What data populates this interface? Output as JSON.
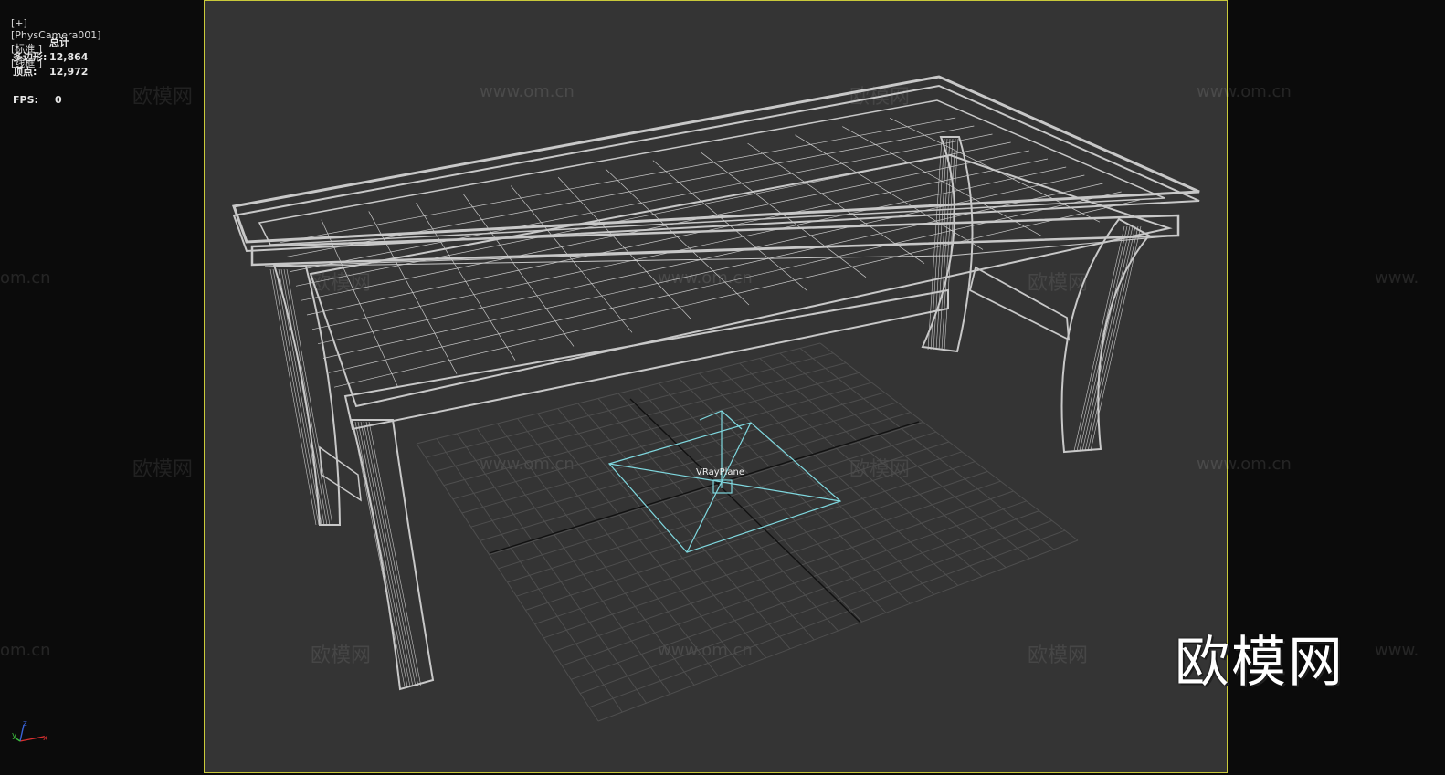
{
  "viewport": {
    "labels": [
      "[+]",
      "[PhysCamera001]",
      "[标准 ]",
      "[线框 ]"
    ]
  },
  "stats": {
    "header": "总计",
    "polygons_label": "多边形:",
    "polygons_value": "12,864",
    "vertices_label": "顶点:",
    "vertices_value": "12,972",
    "fps_label": "FPS:",
    "fps_value": "0"
  },
  "scene": {
    "object_label": "VRayPlane",
    "wireframe_color": "#c8c8c8",
    "helper_color": "#7fd8df",
    "frame_color": "#c9c93a"
  },
  "watermarks": {
    "brand": "欧模网",
    "url": "www.om.cn",
    "partial_url": "om.cn",
    "partial_www": "www."
  },
  "logo": {
    "text": "欧模网"
  },
  "axis": {
    "x": "x",
    "y": "y",
    "z": "z"
  }
}
